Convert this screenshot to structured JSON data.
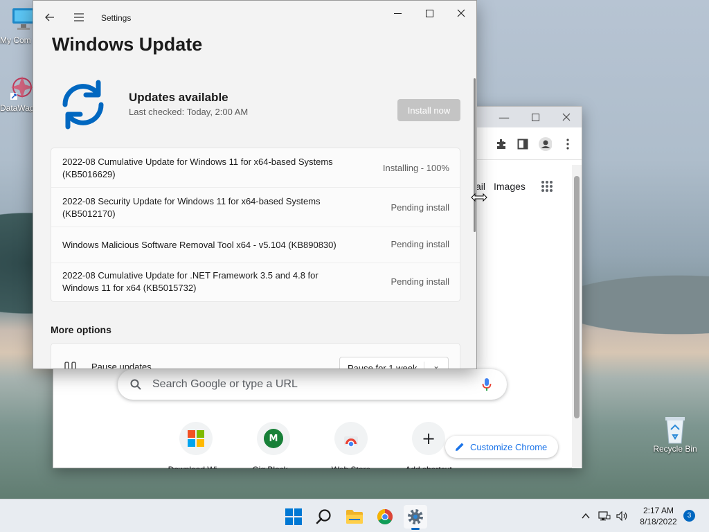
{
  "desktop": {
    "icons": [
      {
        "label": "My Com"
      },
      {
        "label": "DataWag"
      },
      {
        "label": "Recycle Bin"
      }
    ]
  },
  "chrome": {
    "links": {
      "gmail_partial": "ail",
      "images": "Images"
    },
    "search_placeholder": "Search Google or type a URL",
    "shortcuts": [
      {
        "initial": "",
        "label": "Download Wi..."
      },
      {
        "initial": "M",
        "label": "Gig Block..."
      },
      {
        "initial": "",
        "label": "Web Store"
      },
      {
        "initial": "+",
        "label": "Add shortcut"
      }
    ],
    "customize_label": "Customize Chrome"
  },
  "settings": {
    "window_title": "Settings",
    "page_title": "Windows Update",
    "status_title": "Updates available",
    "last_checked": "Last checked: Today, 2:00 AM",
    "install_button": "Install now",
    "updates": [
      {
        "name": "2022-08 Cumulative Update for Windows 11 for x64-based Systems (KB5016629)",
        "status": "Installing - 100%"
      },
      {
        "name": "2022-08 Security Update for Windows 11 for x64-based Systems (KB5012170)",
        "status": "Pending install"
      },
      {
        "name": "Windows Malicious Software Removal Tool x64 - v5.104 (KB890830)",
        "status": "Pending install"
      },
      {
        "name": "2022-08 Cumulative Update for .NET Framework 3.5 and 4.8 for Windows 11 for x64 (KB5015732)",
        "status": "Pending install"
      }
    ],
    "more_options": "More options",
    "pause": {
      "label": "Pause updates",
      "selected": "Pause for 1 week"
    }
  },
  "taskbar": {
    "time": "2:17 AM",
    "date": "8/18/2022",
    "notifications": "3"
  }
}
